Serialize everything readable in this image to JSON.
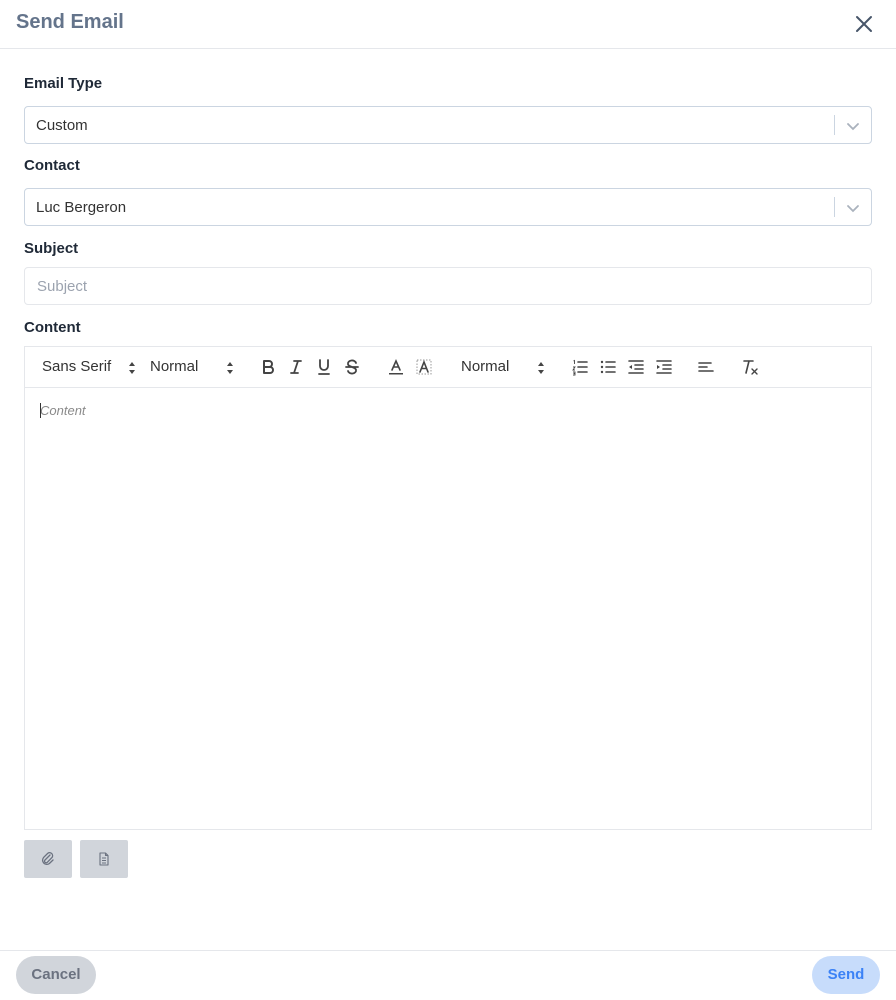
{
  "dialog": {
    "title": "Send Email"
  },
  "form": {
    "email_type": {
      "label": "Email Type",
      "value": "Custom"
    },
    "contact": {
      "label": "Contact",
      "value": "Luc Bergeron"
    },
    "subject": {
      "label": "Subject",
      "value": "",
      "placeholder": "Subject"
    },
    "content": {
      "label": "Content",
      "placeholder": "Content"
    }
  },
  "toolbar": {
    "font": "Sans Serif",
    "size": "Normal",
    "heading": "Normal",
    "icons": [
      "bold-icon",
      "italic-icon",
      "underline-icon",
      "strikethrough-icon",
      "text-color-icon",
      "background-color-icon",
      "ordered-list-icon",
      "bullet-list-icon",
      "outdent-icon",
      "indent-icon",
      "align-left-icon",
      "clear-formatting-icon"
    ]
  },
  "attachments": {
    "icons": [
      "paperclip-icon",
      "document-icon"
    ]
  },
  "footer": {
    "cancel_label": "Cancel",
    "send_label": "Send"
  },
  "colors": {
    "title": "#64748b",
    "send_bg": "#c7dcfb",
    "send_text": "#3b82f6",
    "cancel_bg": "#d1d5db"
  }
}
